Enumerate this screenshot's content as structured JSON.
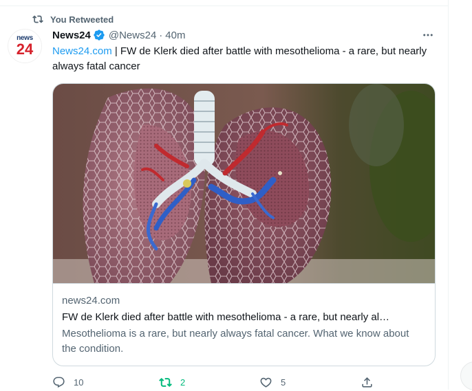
{
  "retweet": {
    "label": "You Retweeted"
  },
  "author": {
    "avatar_top": "news",
    "avatar_num": "24",
    "name": "News24",
    "handle": "@News24",
    "separator": "·",
    "time": "40m"
  },
  "tweet": {
    "link_text": "News24.com",
    "text": " | FW de Klerk died after battle with mesothelioma - a rare, but nearly always fatal cancer"
  },
  "card": {
    "domain": "news24.com",
    "title": "FW de Klerk died after battle with mesothelioma - a rare, but nearly al…",
    "description": "Mesothelioma is a rare, but nearly always fatal cancer. What we know about the condition."
  },
  "actions": {
    "replies": "10",
    "retweets": "2",
    "likes": "5"
  },
  "colors": {
    "accent": "#1d9bf0",
    "retweet_active": "#00ba7c",
    "muted_text": "#536471",
    "brand_red": "#d6212b",
    "brand_navy": "#1d3c6e"
  },
  "icons": [
    "retweet-icon",
    "verified-badge-icon",
    "more-icon",
    "reply-icon",
    "heart-icon",
    "share-icon"
  ]
}
